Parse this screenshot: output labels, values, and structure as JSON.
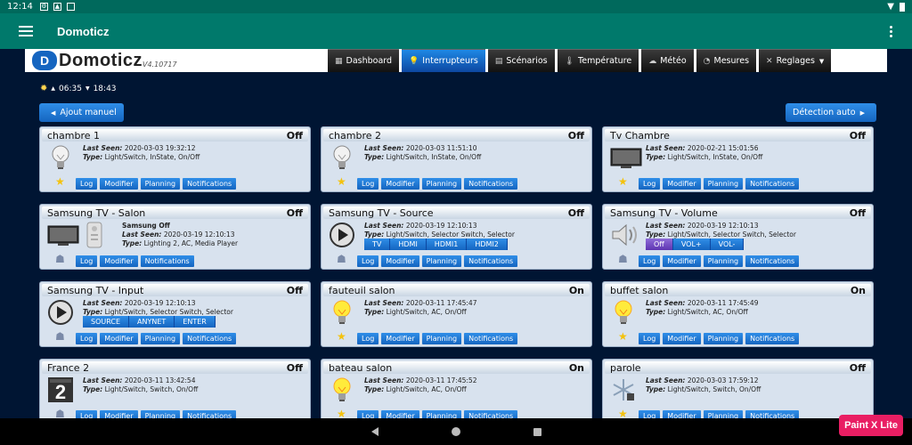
{
  "status": {
    "time": "12:14"
  },
  "appbar": {
    "title": "Domoticz"
  },
  "logo": {
    "name": "Domoticz",
    "version": "V4.10717"
  },
  "nav": [
    {
      "label": "Dashboard",
      "icon": "dashboard-icon"
    },
    {
      "label": "Interrupteurs",
      "icon": "bulb-icon",
      "active": true
    },
    {
      "label": "Scénarios",
      "icon": "scenes-icon"
    },
    {
      "label": "Température",
      "icon": "thermometer-icon"
    },
    {
      "label": "Météo",
      "icon": "weather-icon"
    },
    {
      "label": "Mesures",
      "icon": "gauge-icon"
    },
    {
      "label": "Reglages",
      "icon": "tools-icon",
      "dropdown": true
    }
  ],
  "sun": {
    "rise": "06:35",
    "set": "18:43"
  },
  "actions": {
    "add": "Ajout manuel",
    "detect": "Détection auto"
  },
  "cards": [
    {
      "name": "chambre 1",
      "status": "Off",
      "icon": "bulb-off-icon",
      "seen": "2020-03-03 19:32:12",
      "type": "Light/Switch, InState, On/Off",
      "star": true,
      "buttons": [
        "Log",
        "Modifier",
        "Planning",
        "Notifications"
      ]
    },
    {
      "name": "chambre 2",
      "status": "Off",
      "icon": "bulb-off-icon",
      "seen": "2020-03-03 11:51:10",
      "type": "Light/Switch, InState, On/Off",
      "star": true,
      "buttons": [
        "Log",
        "Modifier",
        "Planning",
        "Notifications"
      ]
    },
    {
      "name": "Tv Chambre",
      "status": "Off",
      "icon": "tv-icon",
      "seen": "2020-02-21 15:01:56",
      "type": "Light/Switch, InState, On/Off",
      "star": true,
      "buttons": [
        "Log",
        "Modifier",
        "Planning",
        "Notifications"
      ]
    },
    {
      "name": "Samsung TV - Salon",
      "status": "Off",
      "icon": "tv-icon",
      "icon2": "remote-icon",
      "label": "Samsung Off",
      "seen": "2020-03-19 12:10:13",
      "type": "Lighting 2, AC, Media Player",
      "star": false,
      "buttons": [
        "Log",
        "Modifier",
        "Notifications"
      ]
    },
    {
      "name": "Samsung TV - Source",
      "status": "Off",
      "icon": "play-icon",
      "seen": "2020-03-19 12:10:13",
      "type": "Light/Switch, Selector Switch, Selector",
      "star": false,
      "options": [
        "TV",
        "HDMI",
        "HDMI1",
        "HDMI2"
      ],
      "buttons": [
        "Log",
        "Modifier",
        "Planning",
        "Notifications"
      ]
    },
    {
      "name": "Samsung TV - Volume",
      "status": "Off",
      "icon": "speaker-icon",
      "seen": "2020-03-19 12:10:13",
      "type": "Light/Switch, Selector Switch, Selector",
      "star": false,
      "options": [
        "Off",
        "VOL+",
        "VOL-"
      ],
      "selected": 0,
      "buttons": [
        "Log",
        "Modifier",
        "Planning",
        "Notifications"
      ]
    },
    {
      "name": "Samsung TV - Input",
      "status": "Off",
      "icon": "play-icon",
      "seen": "2020-03-19 12:10:13",
      "type": "Light/Switch, Selector Switch, Selector",
      "star": false,
      "options": [
        "SOURCE",
        "ANYNET",
        "ENTER"
      ],
      "buttons": [
        "Log",
        "Modifier",
        "Planning",
        "Notifications"
      ]
    },
    {
      "name": "fauteuil salon",
      "status": "On",
      "icon": "bulb-on-icon",
      "seen": "2020-03-11 17:45:47",
      "type": "Light/Switch, AC, On/Off",
      "star": true,
      "buttons": [
        "Log",
        "Modifier",
        "Planning",
        "Notifications"
      ]
    },
    {
      "name": "buffet salon",
      "status": "On",
      "icon": "bulb-on-icon",
      "seen": "2020-03-11 17:45:49",
      "type": "Light/Switch, AC, On/Off",
      "star": true,
      "buttons": [
        "Log",
        "Modifier",
        "Planning",
        "Notifications"
      ]
    },
    {
      "name": "France 2",
      "status": "Off",
      "icon": "france2-icon",
      "seen": "2020-03-11 13:42:54",
      "type": "Light/Switch, Switch, On/Off",
      "star": false,
      "buttons": [
        "Log",
        "Modifier",
        "Planning",
        "Notifications"
      ]
    },
    {
      "name": "bateau salon",
      "status": "On",
      "icon": "bulb-on-icon",
      "seen": "2020-03-11 17:45:52",
      "type": "Light/Switch, AC, On/Off",
      "star": true,
      "buttons": [
        "Log",
        "Modifier",
        "Planning",
        "Notifications"
      ]
    },
    {
      "name": "parole",
      "status": "Off",
      "icon": "snowflake-icon",
      "seen": "2020-03-03 17:59:12",
      "type": "Light/Switch, Switch, On/Off",
      "star": true,
      "buttons": [
        "Log",
        "Modifier",
        "Planning",
        "Notifications"
      ]
    }
  ],
  "labels": {
    "lastSeen": "Last Seen:",
    "type": "Type:"
  },
  "watermark": "Paint X Lite"
}
